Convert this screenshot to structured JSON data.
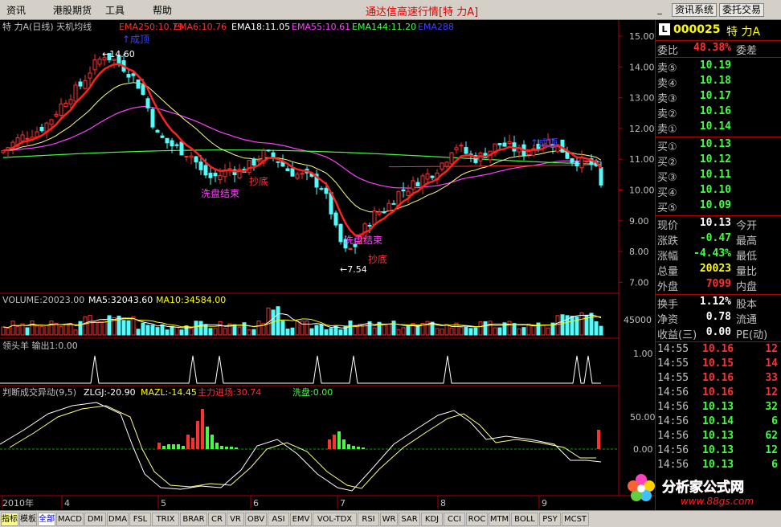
{
  "menu": [
    "资讯",
    "港股期货",
    "工具",
    "帮助"
  ],
  "title": "通达信高速行情[特  力A]",
  "right_buttons": [
    "资讯系统",
    "委托交易"
  ],
  "window_buttons": [
    "_",
    "□",
    "×"
  ],
  "chart_header": {
    "prefix": "特  力A(日线) 天机均线",
    "ema": [
      {
        "label": "EMA250:10.79",
        "color": "#ff3030"
      },
      {
        "label": "EMA6:10.76",
        "color": "#ff3030"
      },
      {
        "label": "EMA18:11.05",
        "color": "#ffffff"
      },
      {
        "label": "EMA55:10.61",
        "color": "#ff40ff"
      },
      {
        "label": "EMA144:11.20",
        "color": "#40ff40"
      },
      {
        "label": "EMA288",
        "color": "#4040ff"
      }
    ]
  },
  "price_axis": [
    "15.00",
    "14.00",
    "13.00",
    "12.00",
    "11.00",
    "10.00",
    "9.00",
    "8.00",
    "7.00"
  ],
  "annotations": {
    "top_marker": "↑成顶",
    "high": "←14.60",
    "wash1": "洗盘结束",
    "buy1": "抄底",
    "wash2": "洗盘结束",
    "buy2": "抄底",
    "low": "←7.54",
    "top2": "↑成顶"
  },
  "volume_header": [
    {
      "label": "VOLUME:20023.00",
      "color": "#c0c0c0"
    },
    {
      "label": "MA5:32043.60",
      "color": "#ffffff"
    },
    {
      "label": "MA10:34584.00",
      "color": "#ffff00"
    }
  ],
  "volume_axis": "45000",
  "leader_header": "领头羊  输出1:0.00",
  "leader_axis": "1.00",
  "flow_header": [
    {
      "label": "判断成交异动(9,5)",
      "color": "#c0c0c0"
    },
    {
      "label": "ZLGJ:-20.90",
      "color": "#ffffff"
    },
    {
      "label": "MAZL:-14.45",
      "color": "#ffff00"
    },
    {
      "label": "主力进场:30.74",
      "color": "#ff3030"
    },
    {
      "label": "洗盘:0.00",
      "color": "#40ff40"
    }
  ],
  "flow_axis": [
    "50.00",
    "0.00"
  ],
  "x_axis": [
    "2010年",
    "4",
    "5",
    "6",
    "7",
    "8",
    "9"
  ],
  "quote": {
    "code": "000025",
    "name": "特  力A",
    "ratio_label": "委比",
    "ratio_value": "48.38%",
    "diff_label": "委差",
    "asks": [
      {
        "label": "卖⑤",
        "price": "10.19"
      },
      {
        "label": "卖④",
        "price": "10.18"
      },
      {
        "label": "卖③",
        "price": "10.17"
      },
      {
        "label": "卖②",
        "price": "10.16"
      },
      {
        "label": "卖①",
        "price": "10.14"
      }
    ],
    "bids": [
      {
        "label": "买①",
        "price": "10.13"
      },
      {
        "label": "买②",
        "price": "10.12"
      },
      {
        "label": "买③",
        "price": "10.11"
      },
      {
        "label": "买④",
        "price": "10.10"
      },
      {
        "label": "买⑤",
        "price": "10.09"
      }
    ],
    "stats": [
      {
        "label": "现价",
        "value": "10.13",
        "label2": "今开",
        "color": "#ffffff"
      },
      {
        "label": "涨跌",
        "value": "-0.47",
        "label2": "最高",
        "color": "#40ff40"
      },
      {
        "label": "涨幅",
        "value": "-4.43%",
        "label2": "最低",
        "color": "#40ff40"
      },
      {
        "label": "总量",
        "value": "20023",
        "label2": "量比",
        "color": "#ffff00"
      },
      {
        "label": "外盘",
        "value": "7099",
        "label2": "内盘",
        "color": "#ff3030"
      }
    ],
    "stats2": [
      {
        "label": "换手",
        "value": "1.12%",
        "label2": "股本"
      },
      {
        "label": "净资",
        "value": "0.78",
        "label2": "流通"
      },
      {
        "label": "收益(三)",
        "value": "0.00",
        "label2": "PE(动)"
      }
    ],
    "ticks": [
      {
        "time": "14:55",
        "price": "10.16",
        "vol": "12",
        "color": "#ff3030"
      },
      {
        "time": "14:55",
        "price": "10.15",
        "vol": "14",
        "color": "#ff3030"
      },
      {
        "time": "14:55",
        "price": "10.16",
        "vol": "33",
        "color": "#ff3030"
      },
      {
        "time": "14:56",
        "price": "10.16",
        "vol": "12",
        "color": "#ff3030"
      },
      {
        "time": "14:56",
        "price": "10.13",
        "vol": "32",
        "color": "#40ff40"
      },
      {
        "time": "14:56",
        "price": "10.14",
        "vol": "6",
        "color": "#40ff40"
      },
      {
        "time": "14:56",
        "price": "10.13",
        "vol": "62",
        "color": "#40ff40"
      },
      {
        "time": "14:56",
        "price": "10.13",
        "vol": "12",
        "color": "#40ff40"
      },
      {
        "time": "14:56",
        "price": "10.13",
        "vol": "6",
        "color": "#40ff40"
      }
    ]
  },
  "tabs": [
    "指标",
    "模板",
    "全部",
    "MACD",
    "DMI",
    "DMA",
    "FSL",
    "TRIX",
    "BRAR",
    "CR",
    "VR",
    "OBV",
    "ASI",
    "EMV",
    "VOL-TDX",
    "RSI",
    "WR",
    "SAR",
    "KDJ",
    "CCI",
    "ROC",
    "MTM",
    "BOLL",
    "PSY",
    "MCST"
  ],
  "watermark": {
    "brand": "分析家公式网",
    "url": "www.88gs.com"
  }
}
